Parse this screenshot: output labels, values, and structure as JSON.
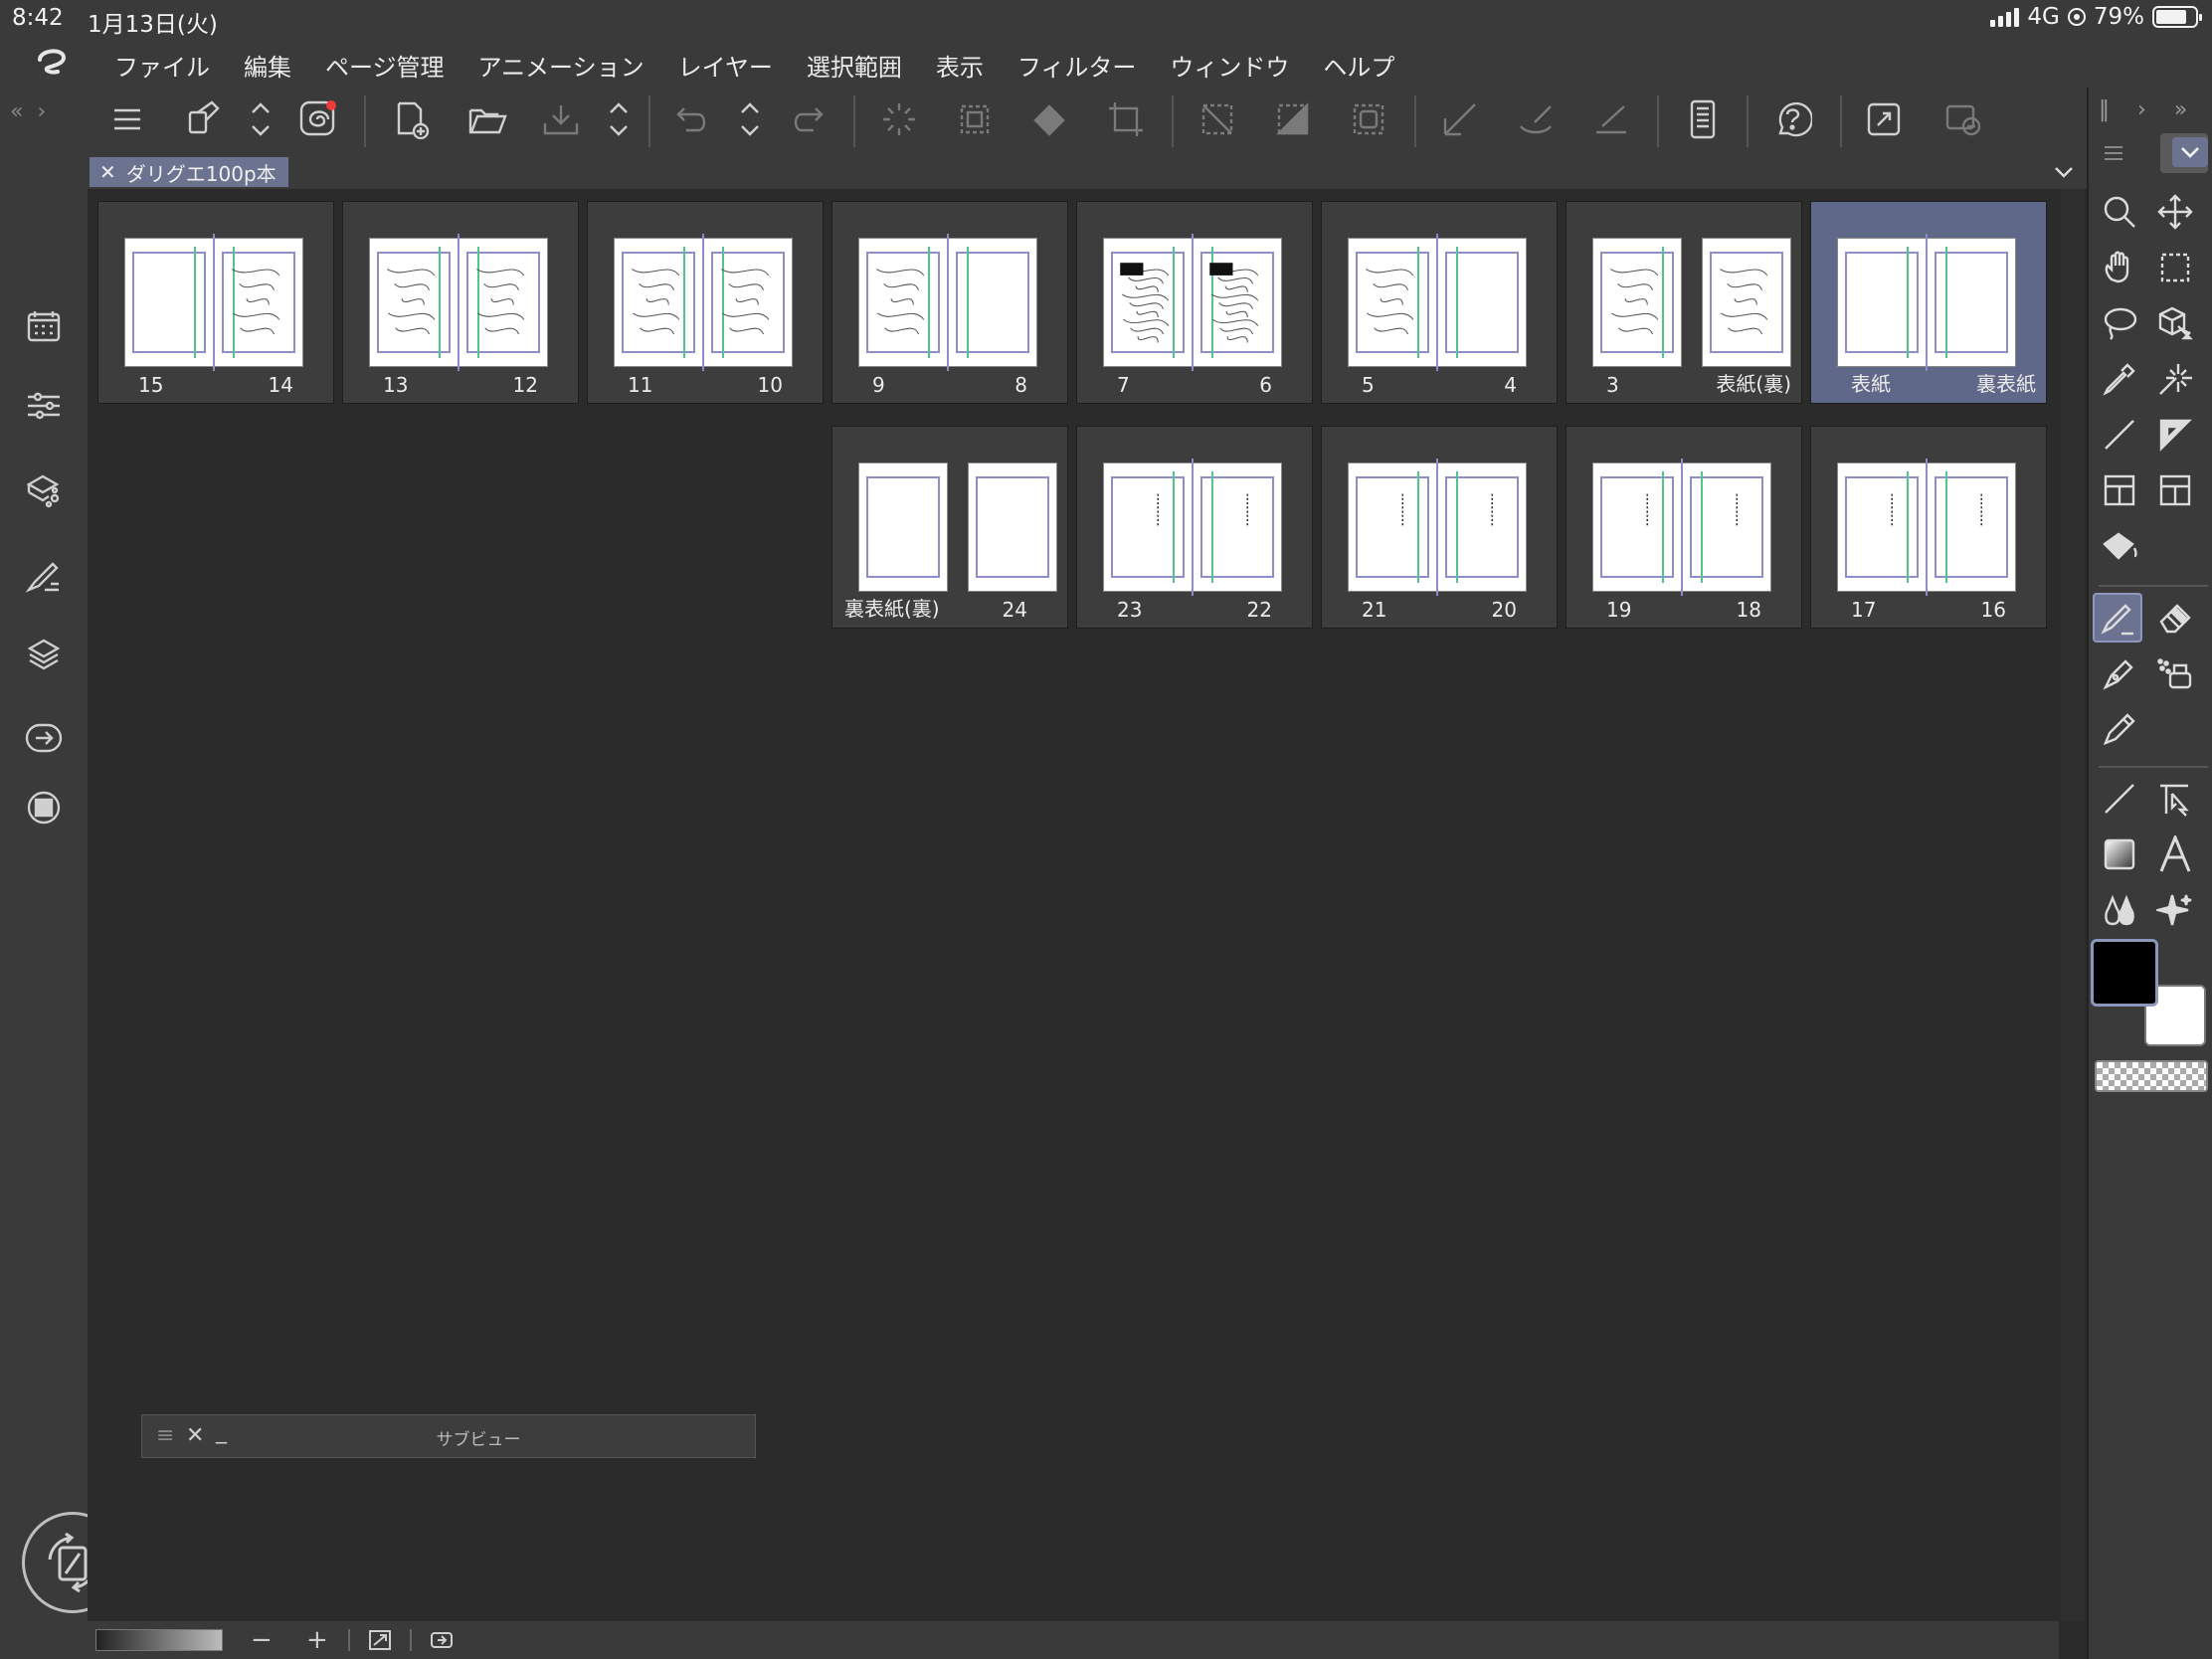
{
  "status": {
    "time": "8:42",
    "date": "1月13日(火)",
    "network": "4G",
    "battery": "79%",
    "battery_level": 0.79
  },
  "menu": {
    "items": [
      "ファイル",
      "編集",
      "ページ管理",
      "アニメーション",
      "レイヤー",
      "選択範囲",
      "表示",
      "フィルター",
      "ウィンドウ",
      "ヘルプ"
    ]
  },
  "document": {
    "tab_title": "ダリグエ100p本"
  },
  "spreads": [
    {
      "left_label": "15",
      "right_label": "14",
      "selected": false
    },
    {
      "left_label": "13",
      "right_label": "12",
      "selected": false
    },
    {
      "left_label": "11",
      "right_label": "10",
      "selected": false
    },
    {
      "left_label": "9",
      "right_label": "8",
      "selected": false
    },
    {
      "left_label": "7",
      "right_label": "6",
      "selected": false
    },
    {
      "left_label": "5",
      "right_label": "4",
      "selected": false
    },
    {
      "left_label": "3",
      "right_label": "表紙(裏)",
      "selected": false
    },
    {
      "left_label": "表紙",
      "right_label": "裏表紙",
      "selected": true
    },
    {
      "left_label": "裏表紙(裏)",
      "right_label": "24",
      "selected": false
    },
    {
      "left_label": "23",
      "right_label": "22",
      "selected": false
    },
    {
      "left_label": "21",
      "right_label": "20",
      "selected": false
    },
    {
      "left_label": "19",
      "right_label": "18",
      "selected": false
    },
    {
      "left_label": "17",
      "right_label": "16",
      "selected": false
    }
  ],
  "subview": {
    "title": "サブビュー",
    "menu_glyph": "≡",
    "close_glyph": "✕",
    "minimize_glyph": "_"
  },
  "bottombar": {
    "zoom_out": "−",
    "zoom_in": "+"
  },
  "colors": {
    "main_color": "#000000",
    "sub_color": "#ffffff",
    "accent": "#6c7391"
  },
  "icons": {
    "toolbar": [
      "menu-icon",
      "fill-bucket-icon",
      "hand-icon",
      "new-page-icon",
      "open-folder-icon",
      "save-icon",
      "undo-icon",
      "redo-icon",
      "transform-icon",
      "selection-icon",
      "help-icon",
      "fullscreen-icon"
    ],
    "left": [
      "pages-icon",
      "properties-icon",
      "sub-tool-icon",
      "brush-size-icon",
      "layer-icon",
      "transfer-icon",
      "color-icon",
      "rotate-view-icon"
    ],
    "right": [
      "zoom-icon",
      "move-icon",
      "hand-icon",
      "marquee-icon",
      "lasso-icon",
      "3d-object-icon",
      "eyedropper-icon",
      "auto-select-icon",
      "ruler-line-icon",
      "ruler-triangle-icon",
      "frame-icon",
      "frame-cut-icon",
      "fill-icon",
      "pen-icon",
      "eraser-icon",
      "marker-icon",
      "airbrush-icon",
      "pencil-icon",
      "line-icon",
      "operation-icon",
      "gradient-icon",
      "text-icon",
      "blend-icon",
      "sparkle-icon"
    ]
  }
}
